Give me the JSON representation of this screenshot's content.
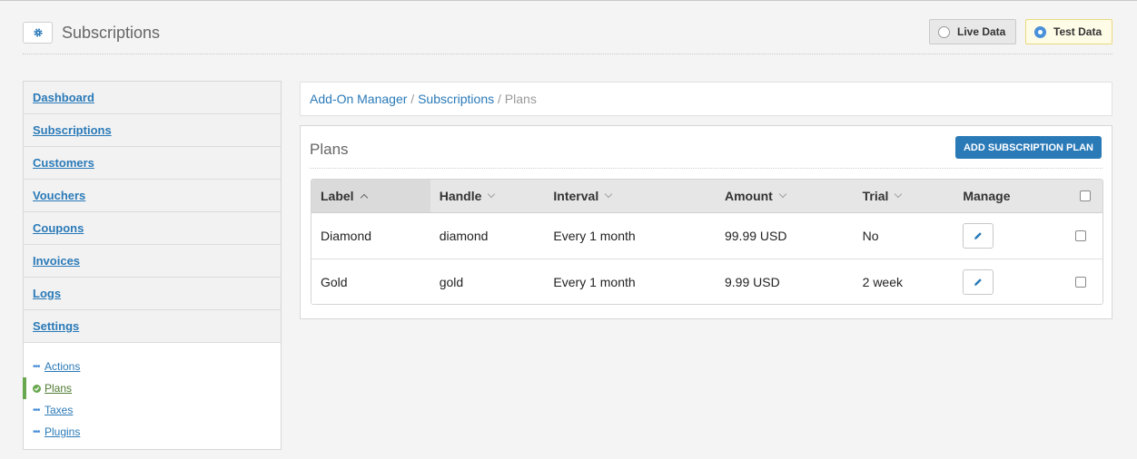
{
  "header": {
    "title": "Subscriptions",
    "settings_icon": "gear-icon",
    "live_label": "Live Data",
    "test_label": "Test Data",
    "selected_mode": "test"
  },
  "sidebar": {
    "items": [
      {
        "label": "Dashboard"
      },
      {
        "label": "Subscriptions"
      },
      {
        "label": "Customers"
      },
      {
        "label": "Vouchers"
      },
      {
        "label": "Coupons"
      },
      {
        "label": "Invoices"
      },
      {
        "label": "Logs"
      },
      {
        "label": "Settings"
      }
    ],
    "subitems": [
      {
        "label": "Actions",
        "active": false
      },
      {
        "label": "Plans",
        "active": true
      },
      {
        "label": "Taxes",
        "active": false
      },
      {
        "label": "Plugins",
        "active": false
      }
    ]
  },
  "breadcrumb": {
    "items": [
      "Add-On Manager",
      "Subscriptions"
    ],
    "separator": "/",
    "current": "Plans"
  },
  "panel": {
    "title": "Plans",
    "add_button": "ADD SUBSCRIPTION PLAN",
    "columns": [
      "Label",
      "Handle",
      "Interval",
      "Amount",
      "Trial",
      "Manage"
    ],
    "sorted_column": "Label",
    "rows": [
      {
        "label": "Diamond",
        "handle": "diamond",
        "interval": "Every 1 month",
        "amount": "99.99 USD",
        "trial": "No"
      },
      {
        "label": "Gold",
        "handle": "gold",
        "interval": "Every 1 month",
        "amount": "9.99 USD",
        "trial": "2 week"
      }
    ]
  },
  "colors": {
    "accent": "#2a7ab8",
    "active_marker": "#6aa84f",
    "test_mode_bg": "#fefbe6"
  }
}
